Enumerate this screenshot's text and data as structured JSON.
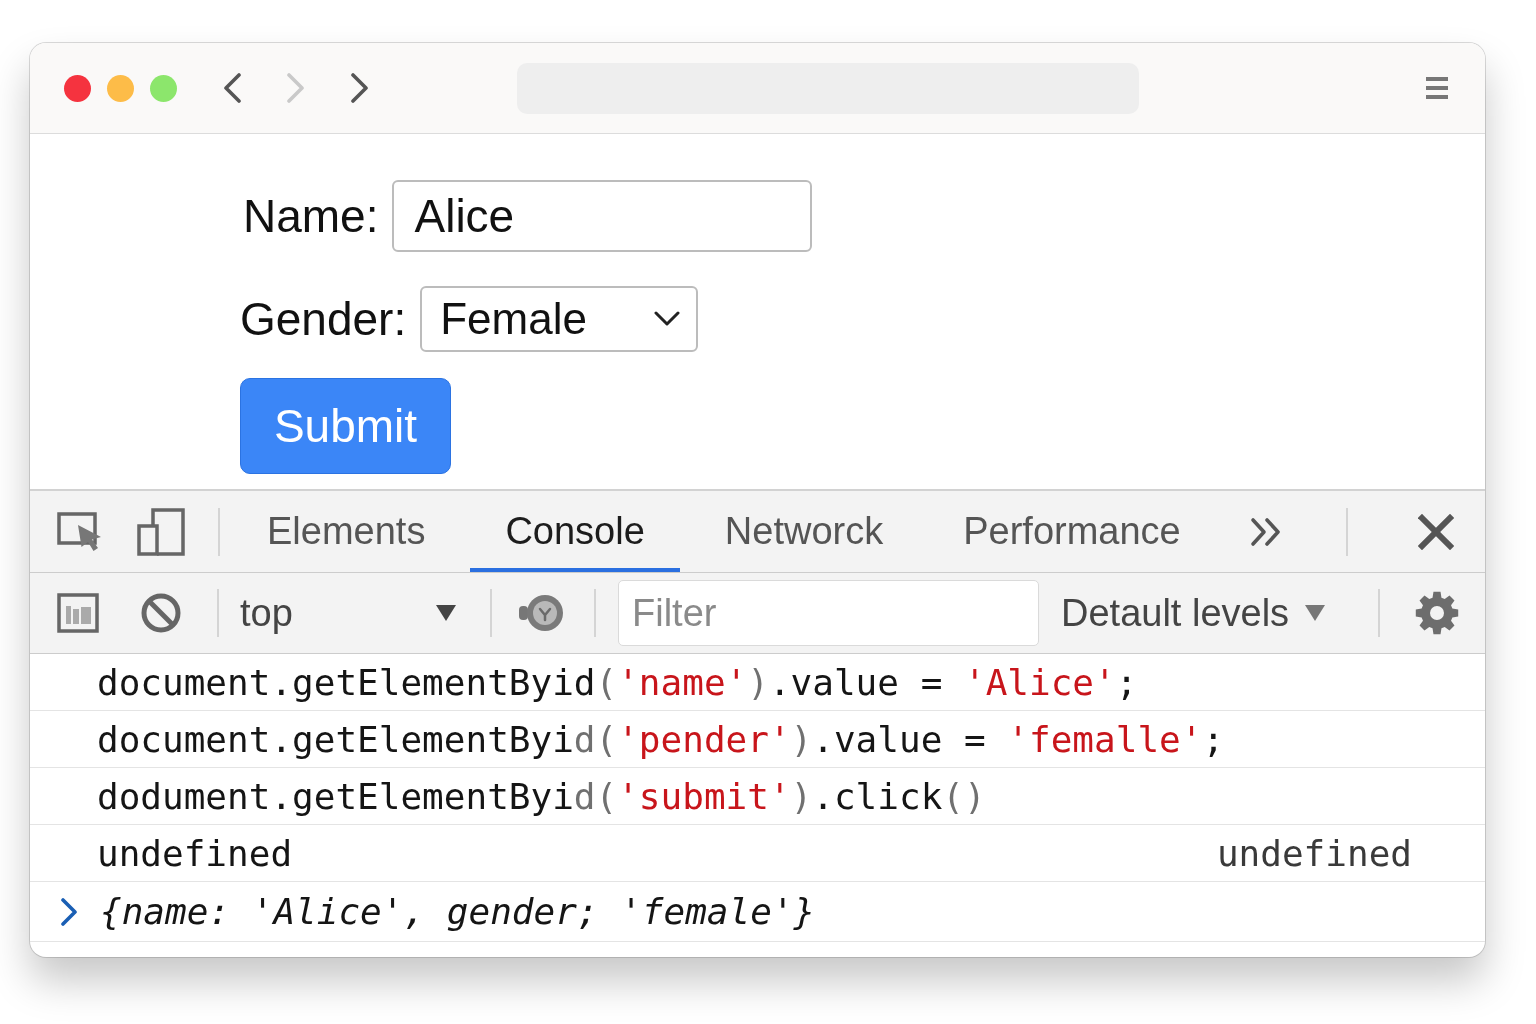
{
  "browser": {
    "controls": [
      {
        "color": "#f5333f"
      },
      {
        "color": "#fdbc48"
      },
      {
        "color": "#8ce66c"
      }
    ],
    "nav": [
      {
        "kind": "back",
        "disabled": false
      },
      {
        "kind": "forward",
        "disabled": true
      },
      {
        "kind": "forward",
        "disabled": false
      }
    ]
  },
  "page": {
    "fields": [
      {
        "kind": "text",
        "label": "Name:",
        "value": "Alice"
      },
      {
        "kind": "select",
        "label": "Gender:",
        "value": "Female"
      }
    ],
    "submit": "Submit"
  },
  "devtools": {
    "tabs": [
      {
        "label": "Elements",
        "selected": false
      },
      {
        "label": "Console",
        "selected": true
      },
      {
        "label": "Networck",
        "selected": false
      },
      {
        "label": "Performance",
        "selected": false
      }
    ],
    "context": "top",
    "filter": {
      "placeholder": "Filter"
    },
    "levels": "Detault levels",
    "console": [
      {
        "kind": "input",
        "tokens": [
          {
            "kind": "code",
            "text": "document.getElementByid"
          },
          {
            "kind": "punct",
            "text": "("
          },
          {
            "kind": "string",
            "text": "'name'"
          },
          {
            "kind": "punct",
            "text": ")"
          },
          {
            "kind": "code",
            "text": ".value = "
          },
          {
            "kind": "string",
            "text": "'Alice'"
          },
          {
            "kind": "code",
            "text": ";"
          }
        ]
      },
      {
        "kind": "input",
        "tokens": [
          {
            "kind": "code",
            "text": "document.getElementByi"
          },
          {
            "kind": "punct",
            "text": "d("
          },
          {
            "kind": "string",
            "text": "'pender'"
          },
          {
            "kind": "punct",
            "text": ")"
          },
          {
            "kind": "code",
            "text": ".value = "
          },
          {
            "kind": "string",
            "text": "'femalle'"
          },
          {
            "kind": "code",
            "text": ";"
          }
        ]
      },
      {
        "kind": "input",
        "tokens": [
          {
            "kind": "code",
            "text": "dodument.getElementByi"
          },
          {
            "kind": "punct",
            "text": "d("
          },
          {
            "kind": "string",
            "text": "'submit'"
          },
          {
            "kind": "punct",
            "text": ")"
          },
          {
            "kind": "code",
            "text": ".click"
          },
          {
            "kind": "punct",
            "text": "()"
          }
        ]
      },
      {
        "kind": "result",
        "left": "undefined",
        "right": "undefined"
      },
      {
        "kind": "output",
        "text": "{name: 'Alice', gender; 'female'}"
      }
    ]
  }
}
